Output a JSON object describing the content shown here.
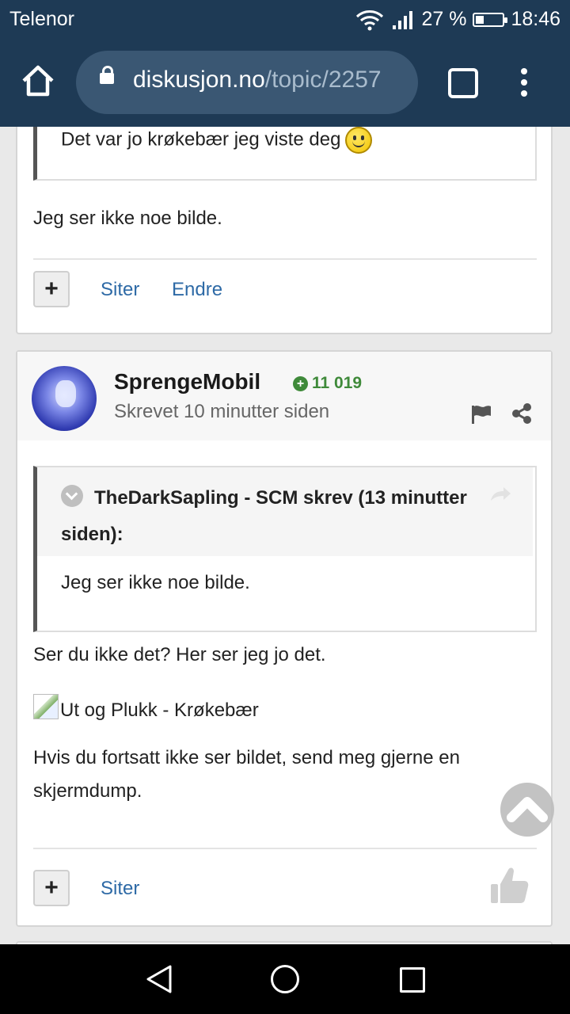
{
  "status_bar": {
    "carrier": "Telenor",
    "battery": "27 %",
    "battery_level": 0.27,
    "time": "18:46",
    "icons": [
      "wifi-icon",
      "signal-icon",
      "battery-icon"
    ]
  },
  "browser": {
    "url_domain": "diskusjon.no",
    "url_path": "/topic/2257",
    "icons": [
      "home-icon",
      "lock-icon",
      "tabs-icon",
      "more-menu-icon"
    ]
  },
  "post1": {
    "quote_text": "Det var jo krøkebær jeg viste deg",
    "body": "Jeg ser ikke noe bilde.",
    "plus_label": "+",
    "quote_link": "Siter",
    "edit_link": "Endre"
  },
  "post2": {
    "author": "SprengeMobil",
    "reputation": "11 019",
    "posted": "Skrevet 10 minutter siden",
    "quote_author": "TheDarkSapling - SCM skrev (13 minutter siden):",
    "quote_body": "Jeg ser ikke noe bilde.",
    "body_line1": "Ser du ikke det? Her ser jeg jo det.",
    "image_alt": "Ut og Plukk - Krøkebær",
    "body_line2": "Hvis du fortsatt ikke ser bildet, send meg gjerne en skjermdump.",
    "plus_label": "+",
    "quote_link": "Siter"
  },
  "colors": {
    "browser_bar": "#1e3a55",
    "url_pill": "#3a5773",
    "link": "#2e6aa6",
    "reputation": "#3f8a3a"
  }
}
